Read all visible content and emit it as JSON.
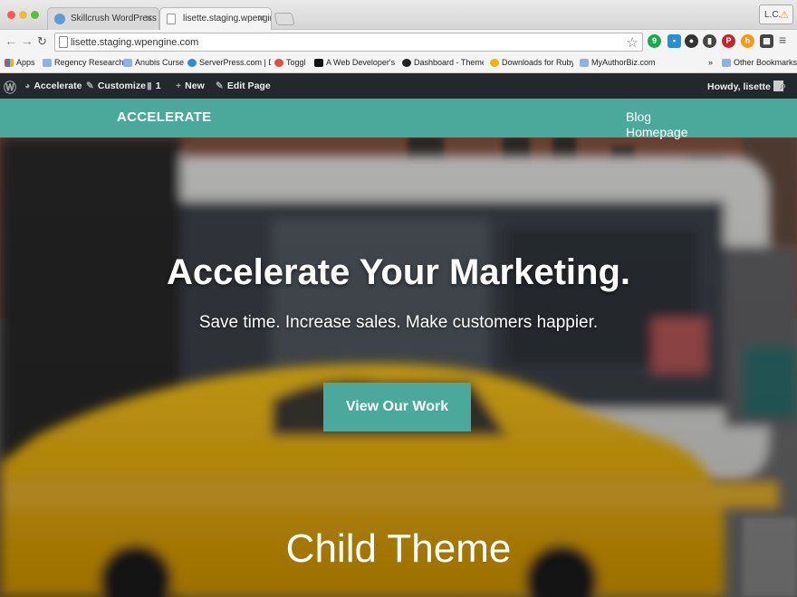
{
  "browser": {
    "tabs": [
      {
        "title": "Skillcrush WordPress Deve",
        "active": false
      },
      {
        "title": "lisette.staging.wpengine.co",
        "active": true
      }
    ],
    "profile_label": "L.C.",
    "url": "lisette.staging.wpengine.com",
    "bookmarks": [
      "Apps",
      "Regency Research",
      "Anubis Curse",
      "ServerPress.com | De",
      "Toggl",
      "A Web Developer's G",
      "Dashboard - Themes",
      "Downloads for Ruby",
      "MyAuthorBiz.com"
    ],
    "more_bookmarks": "»",
    "other_bookmarks": "Other Bookmarks"
  },
  "wp_admin_bar": {
    "site_name": "Accelerate",
    "customize": "Customize",
    "comments_count": "1",
    "new_label": "New",
    "edit_page": "Edit Page",
    "howdy": "Howdy, lisette"
  },
  "site": {
    "brand": "ACCELERATE",
    "menu": [
      "Blog",
      "Homepage"
    ],
    "hero_title": "Accelerate Your Marketing.",
    "hero_subtitle": "Save time. Increase sales. Make customers happier.",
    "cta_label": "View Our Work",
    "child_theme_text": "Child Theme"
  },
  "colors": {
    "accent": "#4aa99a",
    "admin_bar": "#23282d",
    "taxi_yellow": "#f2b400"
  }
}
